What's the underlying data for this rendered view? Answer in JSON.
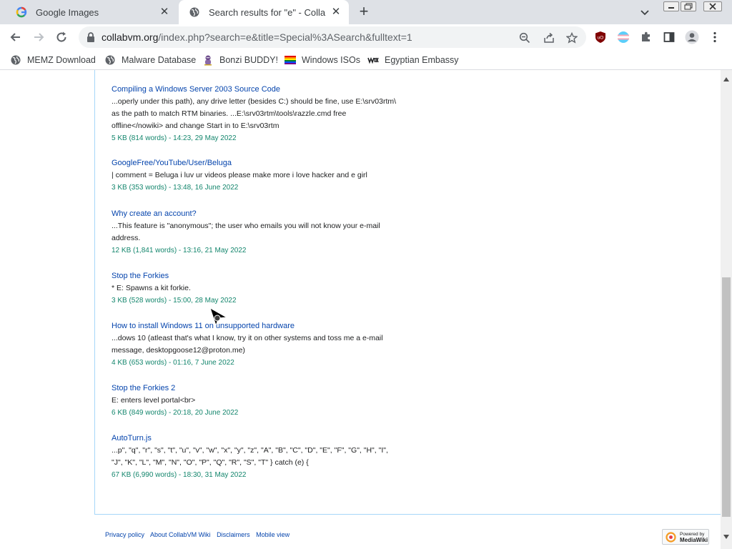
{
  "tabs": [
    {
      "title": "Google Images",
      "active": false
    },
    {
      "title": "Search results for \"e\" - CollabVM",
      "active": true
    }
  ],
  "address": {
    "host": "collabvm.org",
    "path": "/index.php?search=e&title=Special%3ASearch&fulltext=1"
  },
  "bookmarks": [
    {
      "label": "MEMZ Download",
      "icon": "globe-icon"
    },
    {
      "label": "Malware Database",
      "icon": "globe-icon"
    },
    {
      "label": "Bonzi BUDDY!",
      "icon": "bonzi-icon"
    },
    {
      "label": "Windows ISOs",
      "icon": "rainbow-flag-icon"
    },
    {
      "label": "Egyptian Embassy",
      "icon": "wix-icon"
    }
  ],
  "results": [
    {
      "title": "Compiling a Windows Server 2003 Source Code",
      "snippet_lines": [
        "...operly under this path), any drive letter (besides C:) should be fine, use E:\\srv03rtm\\",
        "as the path to match RTM binaries. ...E:\\srv03rtm\\tools\\razzle.cmd free",
        "offline</nowiki> and change Start in to E:\\srv03rtm"
      ],
      "meta": "5 KB (814 words) - 14:23, 29 May 2022"
    },
    {
      "title": "GoogleFree/YouTube/User/Beluga",
      "snippet_lines": [
        "| comment = Beluga i luv ur videos please make more i love hacker and e girl"
      ],
      "meta": "3 KB (353 words) - 13:48, 16 June 2022"
    },
    {
      "title": "Why create an account?",
      "snippet_lines": [
        "...This feature is \"anonymous\"; the user who emails you will not know your e-mail",
        "address."
      ],
      "meta": "12 KB (1,841 words) - 13:16, 21 May 2022"
    },
    {
      "title": "Stop the Forkies",
      "snippet_lines": [
        "* E: Spawns a kit forkie."
      ],
      "meta": "3 KB (528 words) - 15:00, 28 May 2022"
    },
    {
      "title": "How to install Windows 11 on unsupported hardware",
      "snippet_lines": [
        "...dows 10 (atleast that's what I know, try it on other systems and toss me a e-mail",
        "message, desktopgoose12@proton.me)"
      ],
      "meta": "4 KB (653 words) - 01:16, 7 June 2022"
    },
    {
      "title": "Stop the Forkies 2",
      "snippet_lines": [
        "E: enters level portal<br>"
      ],
      "meta": "6 KB (849 words) - 20:18, 20 June 2022"
    },
    {
      "title": "AutoTurn.js",
      "snippet_lines": [
        "...p\", \"q\", \"r\", \"s\", \"t\", \"u\", \"v\", \"w\", \"x\", \"y\", \"z\", \"A\", \"B\", \"C\", \"D\", \"E\", \"F\", \"G\", \"H\", \"I\",",
        "\"J\", \"K\", \"L\", \"M\", \"N\", \"O\", \"P\", \"Q\", \"R\", \"S\", \"T\" } catch (e) {"
      ],
      "meta": "67 KB (6,990 words) - 18:30, 31 May 2022"
    }
  ],
  "footer": {
    "links": [
      "Privacy policy",
      "About CollabVM Wiki",
      "Disclaimers",
      "Mobile view"
    ]
  },
  "powered": {
    "small": "Powered by",
    "big": "MediaWiki"
  },
  "colors": {
    "link": "#0645ad",
    "meta": "#14866d",
    "chrome": "#dee1e6",
    "ublock": "#800000"
  }
}
